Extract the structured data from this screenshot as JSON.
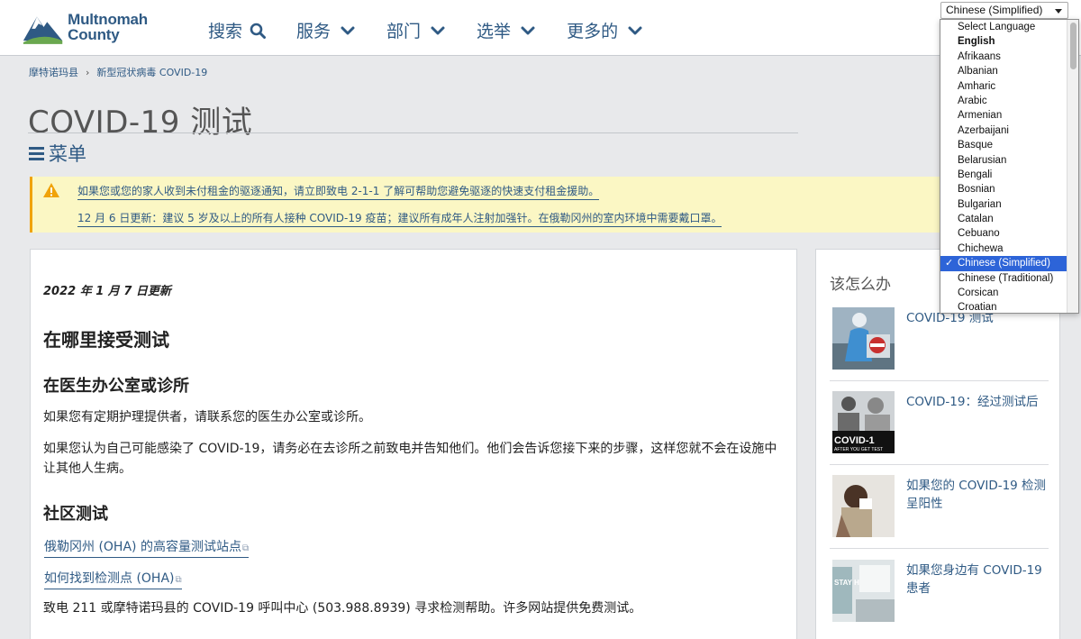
{
  "header": {
    "logo": {
      "line1": "Multnomah",
      "line2": "County"
    },
    "nav": [
      {
        "label": "搜索",
        "icon": "search-icon"
      },
      {
        "label": "服务",
        "icon": "chevron-down-icon"
      },
      {
        "label": "部门",
        "icon": "chevron-down-icon"
      },
      {
        "label": "选举",
        "icon": "chevron-down-icon"
      },
      {
        "label": "更多的",
        "icon": "chevron-down-icon"
      }
    ]
  },
  "breadcrumb": {
    "items": [
      "摩特诺玛县",
      "新型冠状病毒 COVID-19"
    ],
    "separator": "›"
  },
  "page": {
    "title": "COVID-19 测试",
    "menu_label": "菜单"
  },
  "alert": {
    "lines": [
      "如果您或您的家人收到未付租金的驱逐通知，请立即致电 2-1-1 了解可帮助您避免驱逐的快速支付租金援助。",
      "12 月 6 日更新：建议 5 岁及以上的所有人接种 COVID-19 疫苗；建议所有成年人注射加强针。在俄勒冈州的室内环境中需要戴口罩。"
    ]
  },
  "main": {
    "updated": "2022 年 1 月 7 日更新",
    "h2": "在哪里接受测试",
    "h3_doctor": "在医生办公室或诊所",
    "p_doctor_1": "如果您有定期护理提供者，请联系您的医生办公室或诊所。",
    "p_doctor_2": "如果您认为自己可能感染了 COVID-19，请务必在去诊所之前致电并告知他们。他们会告诉您接下来的步骤，这样您就不会在设施中让其他人生病。",
    "h3_community": "社区测试",
    "link_1": "俄勒冈州 (OHA) 的高容量测试站点",
    "link_2": "如何找到检测点 (OHA)",
    "p_community": "致电 211 或摩特诺玛县的 COVID-19 呼叫中心 (503.988.8939) 寻求检测帮助。许多网站提供免费测试。"
  },
  "sidebar": {
    "title": "该怎么办",
    "cards": [
      {
        "label": "COVID-19 测试"
      },
      {
        "label": "COVID-19：经过测试后",
        "thumb_text": "COVID-1",
        "thumb_sub": "AFTER YOU GET TEST"
      },
      {
        "label": "如果您的 COVID-19 检测呈阳性"
      },
      {
        "label": "如果您身边有 COVID-19 患者",
        "thumb_text": "STAY HOME"
      }
    ]
  },
  "language": {
    "selected": "Chinese (Simplified)",
    "options": [
      "Select Language",
      "English",
      "Afrikaans",
      "Albanian",
      "Amharic",
      "Arabic",
      "Armenian",
      "Azerbaijani",
      "Basque",
      "Belarusian",
      "Bengali",
      "Bosnian",
      "Bulgarian",
      "Catalan",
      "Cebuano",
      "Chichewa",
      "Chinese (Simplified)",
      "Chinese (Traditional)",
      "Corsican",
      "Croatian"
    ],
    "bold_option": "English",
    "checkmark": "✓"
  },
  "colors": {
    "link": "#2f5a84",
    "alert_bg": "#fbf7c4",
    "alert_border": "#f0a30a",
    "selected_option": "#2d64d8"
  }
}
